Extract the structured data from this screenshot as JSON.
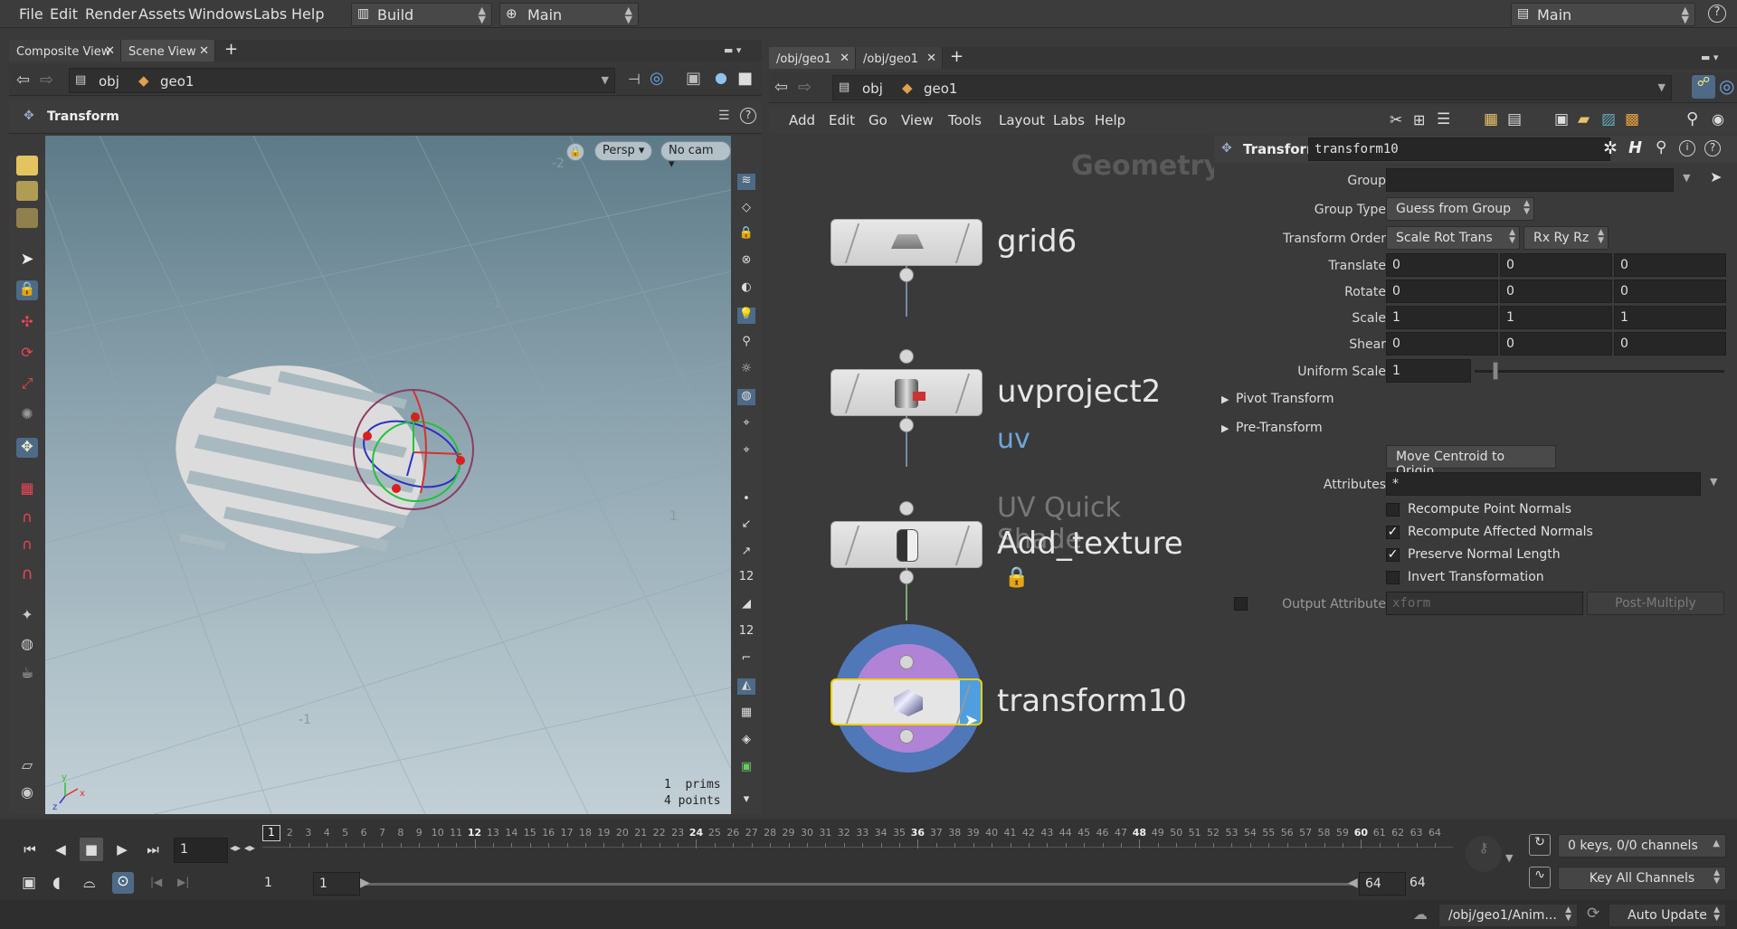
{
  "menu": {
    "file": "File",
    "edit": "Edit",
    "render": "Render",
    "assets": "Assets",
    "windows": "Windows",
    "labs": "Labs",
    "help": "Help"
  },
  "desktop": "Build",
  "context": "Main",
  "right_desktop": "Main",
  "left_tabs": [
    {
      "label": "Composite View"
    },
    {
      "label": "Scene View"
    }
  ],
  "right_tabs": [
    {
      "label": "/obj/geo1"
    },
    {
      "label": "/obj/geo1"
    }
  ],
  "left_path": {
    "obj": "obj",
    "geo": "geo1"
  },
  "right_path": {
    "obj": "obj",
    "geo": "geo1"
  },
  "viewer": {
    "tool_title": "Transform",
    "persp": "Persp",
    "cam": "No cam",
    "prims_label": "1  prims",
    "points_label": "4 points"
  },
  "net_menu": {
    "add": "Add",
    "edit": "Edit",
    "go": "Go",
    "view": "View",
    "tools": "Tools",
    "layout": "Layout",
    "labs": "Labs",
    "help": "Help"
  },
  "network": {
    "context_label": "Geometry",
    "nodes": [
      {
        "name": "grid6"
      },
      {
        "name": "uvproject2",
        "sub": "uv"
      },
      {
        "name": "Add_texture",
        "comment": "UV Quick Shade"
      },
      {
        "name": "transform10"
      }
    ]
  },
  "parm": {
    "type": "Transform",
    "node_name": "transform10",
    "group_label": "Group",
    "group_value": "",
    "group_type_label": "Group Type",
    "group_type": "Guess from Group",
    "xform_order_label": "Transform Order",
    "xform_order": "Scale Rot Trans",
    "rot_order": "Rx Ry Rz",
    "translate_label": "Translate",
    "translate": [
      "0",
      "0",
      "0"
    ],
    "rotate_label": "Rotate",
    "rotate": [
      "0",
      "0",
      "0"
    ],
    "scale_label": "Scale",
    "scale": [
      "1",
      "1",
      "1"
    ],
    "shear_label": "Shear",
    "shear": [
      "0",
      "0",
      "0"
    ],
    "uniform_label": "Uniform Scale",
    "uniform": "1",
    "uniform_slider": 0.0,
    "pivot": "Pivot Transform",
    "pre": "Pre-Transform",
    "move_centroid": "Move Centroid to Origin",
    "attributes_label": "Attributes",
    "attributes": "*",
    "recompute_point": "Recompute Point Normals",
    "recompute_affected": "Recompute Affected Normals",
    "preserve_length": "Preserve Normal Length",
    "invert": "Invert Transformation",
    "output_attr_label": "Output Attribute",
    "output_attr": "xform",
    "post_multiply": "Post-Multiply"
  },
  "timeline": {
    "frame": "1",
    "ticks": [
      "1",
      "2",
      "3",
      "4",
      "5",
      "6",
      "7",
      "8",
      "9",
      "10",
      "11",
      "12",
      "13",
      "14",
      "15",
      "16",
      "17",
      "18",
      "19",
      "20",
      "21",
      "22",
      "23",
      "24",
      "25",
      "26",
      "27",
      "28",
      "29",
      "30",
      "31",
      "32",
      "33",
      "34",
      "35",
      "36",
      "37",
      "38",
      "39",
      "40",
      "41",
      "42",
      "43",
      "44",
      "45",
      "46",
      "47",
      "48",
      "49",
      "50",
      "51",
      "52",
      "53",
      "54",
      "55",
      "56",
      "57",
      "58",
      "59",
      "60",
      "61",
      "62",
      "63",
      "64"
    ],
    "start": "1",
    "start2": "1",
    "end": "64",
    "end2": "64",
    "keys": "0 keys, 0/0 channels",
    "key_all": "Key All Channels"
  },
  "status": {
    "path": "/obj/geo1/Anim...",
    "update": "Auto Update"
  }
}
